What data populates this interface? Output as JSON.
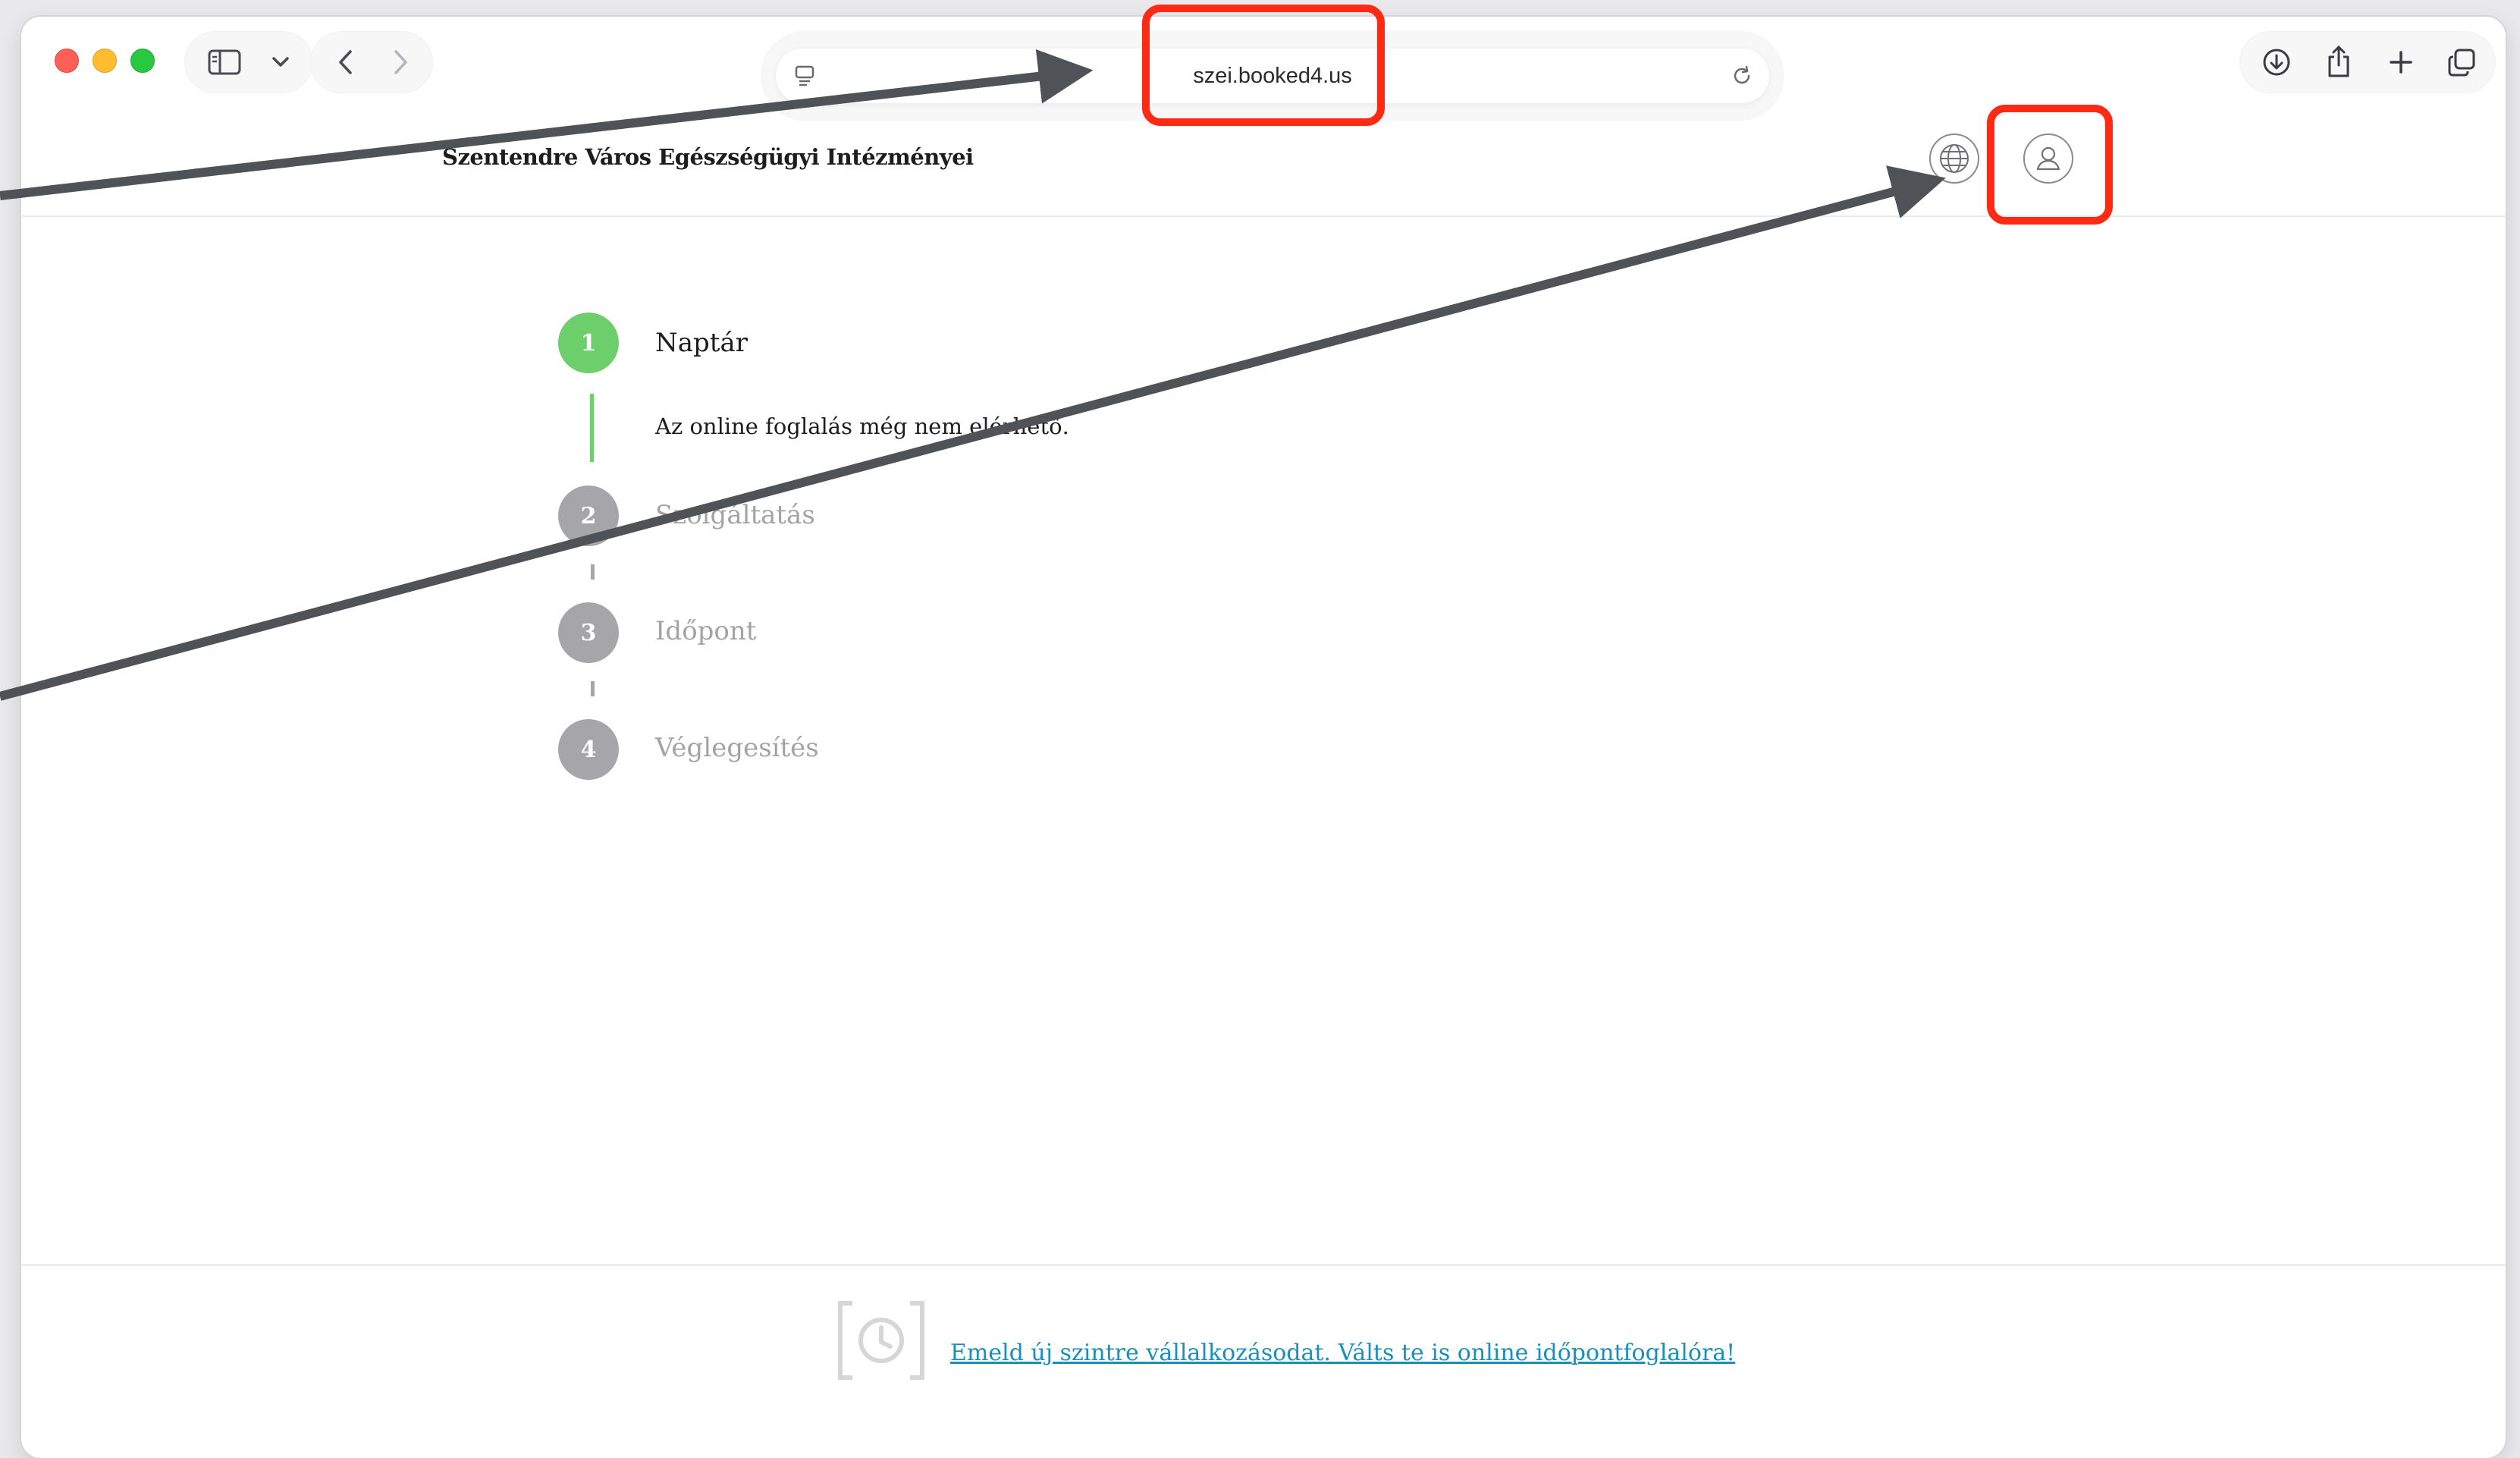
{
  "browser": {
    "url": "szei.booked4.us",
    "icons": {
      "close": "close-dot",
      "minimize": "minimize-dot",
      "maximize": "maximize-dot",
      "sidebar": "sidebar-icon",
      "chevron": "chevron-down-icon",
      "back": "back-arrow-icon",
      "forward": "forward-arrow-icon",
      "reader": "reader-icon",
      "reload": "reload-icon",
      "download": "download-icon",
      "share": "share-icon",
      "new_tab": "plus-icon",
      "tabs": "tab-overview-icon"
    }
  },
  "header": {
    "site_title": "Szentendre Város Egészségügyi Intézményei",
    "language_icon": "globe-icon",
    "account_icon": "user-icon"
  },
  "steps": [
    {
      "number": "1",
      "label": "Naptár",
      "state": "active"
    },
    {
      "number": "2",
      "label": "Szolgáltatás",
      "state": "inactive"
    },
    {
      "number": "3",
      "label": "Időpont",
      "state": "inactive"
    },
    {
      "number": "4",
      "label": "Véglegesítés",
      "state": "inactive"
    }
  ],
  "step_message": "Az online foglalás még nem elérhető.",
  "footer": {
    "link_text": "Emeld új szintre vállalkozásodat. Válts te is online időpontfoglalóra!",
    "logo_icon": "clock-bracket-logo"
  },
  "colors": {
    "active_step": "#6ccf6c",
    "inactive_step": "#a6a6a8",
    "link": "#1a8fb8",
    "annotation": "#ff2a14",
    "arrow": "#4f5257"
  }
}
